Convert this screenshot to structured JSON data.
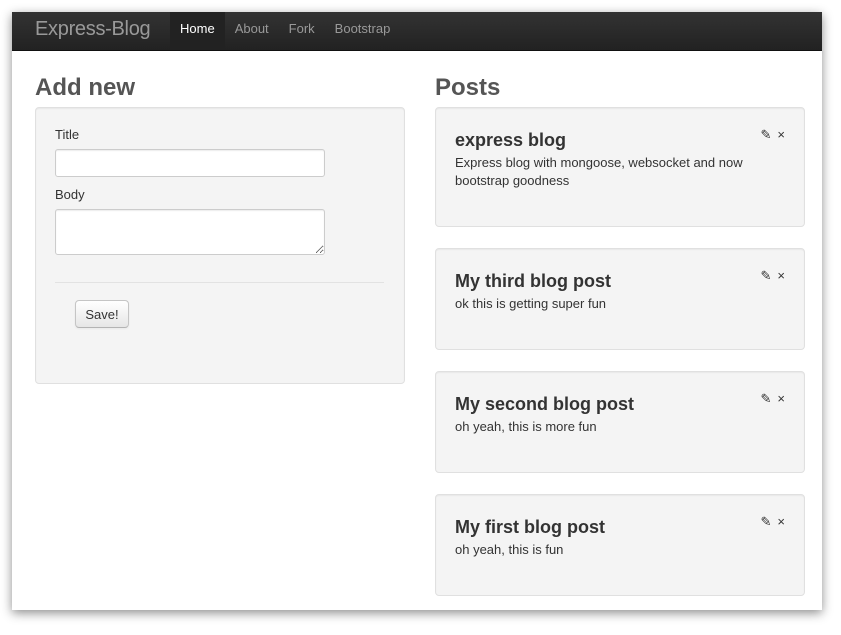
{
  "navbar": {
    "brand": "Express-Blog",
    "items": [
      {
        "label": "Home",
        "active": true
      },
      {
        "label": "About"
      },
      {
        "label": "Fork"
      },
      {
        "label": "Bootstrap"
      }
    ]
  },
  "add_new": {
    "heading": "Add new",
    "title_label": "Title",
    "title_value": "",
    "body_label": "Body",
    "body_value": "",
    "save_label": "Save!"
  },
  "posts": {
    "heading": "Posts",
    "edit_icon": "✎",
    "delete_icon": "×",
    "items": [
      {
        "title": "express blog",
        "body": "Express blog with mongoose, websocket and now bootstrap goodness"
      },
      {
        "title": "My third blog post",
        "body": "ok this is getting super fun"
      },
      {
        "title": "My second blog post",
        "body": "oh yeah, this is more fun"
      },
      {
        "title": "My first blog post",
        "body": "oh yeah, this is fun"
      }
    ]
  }
}
